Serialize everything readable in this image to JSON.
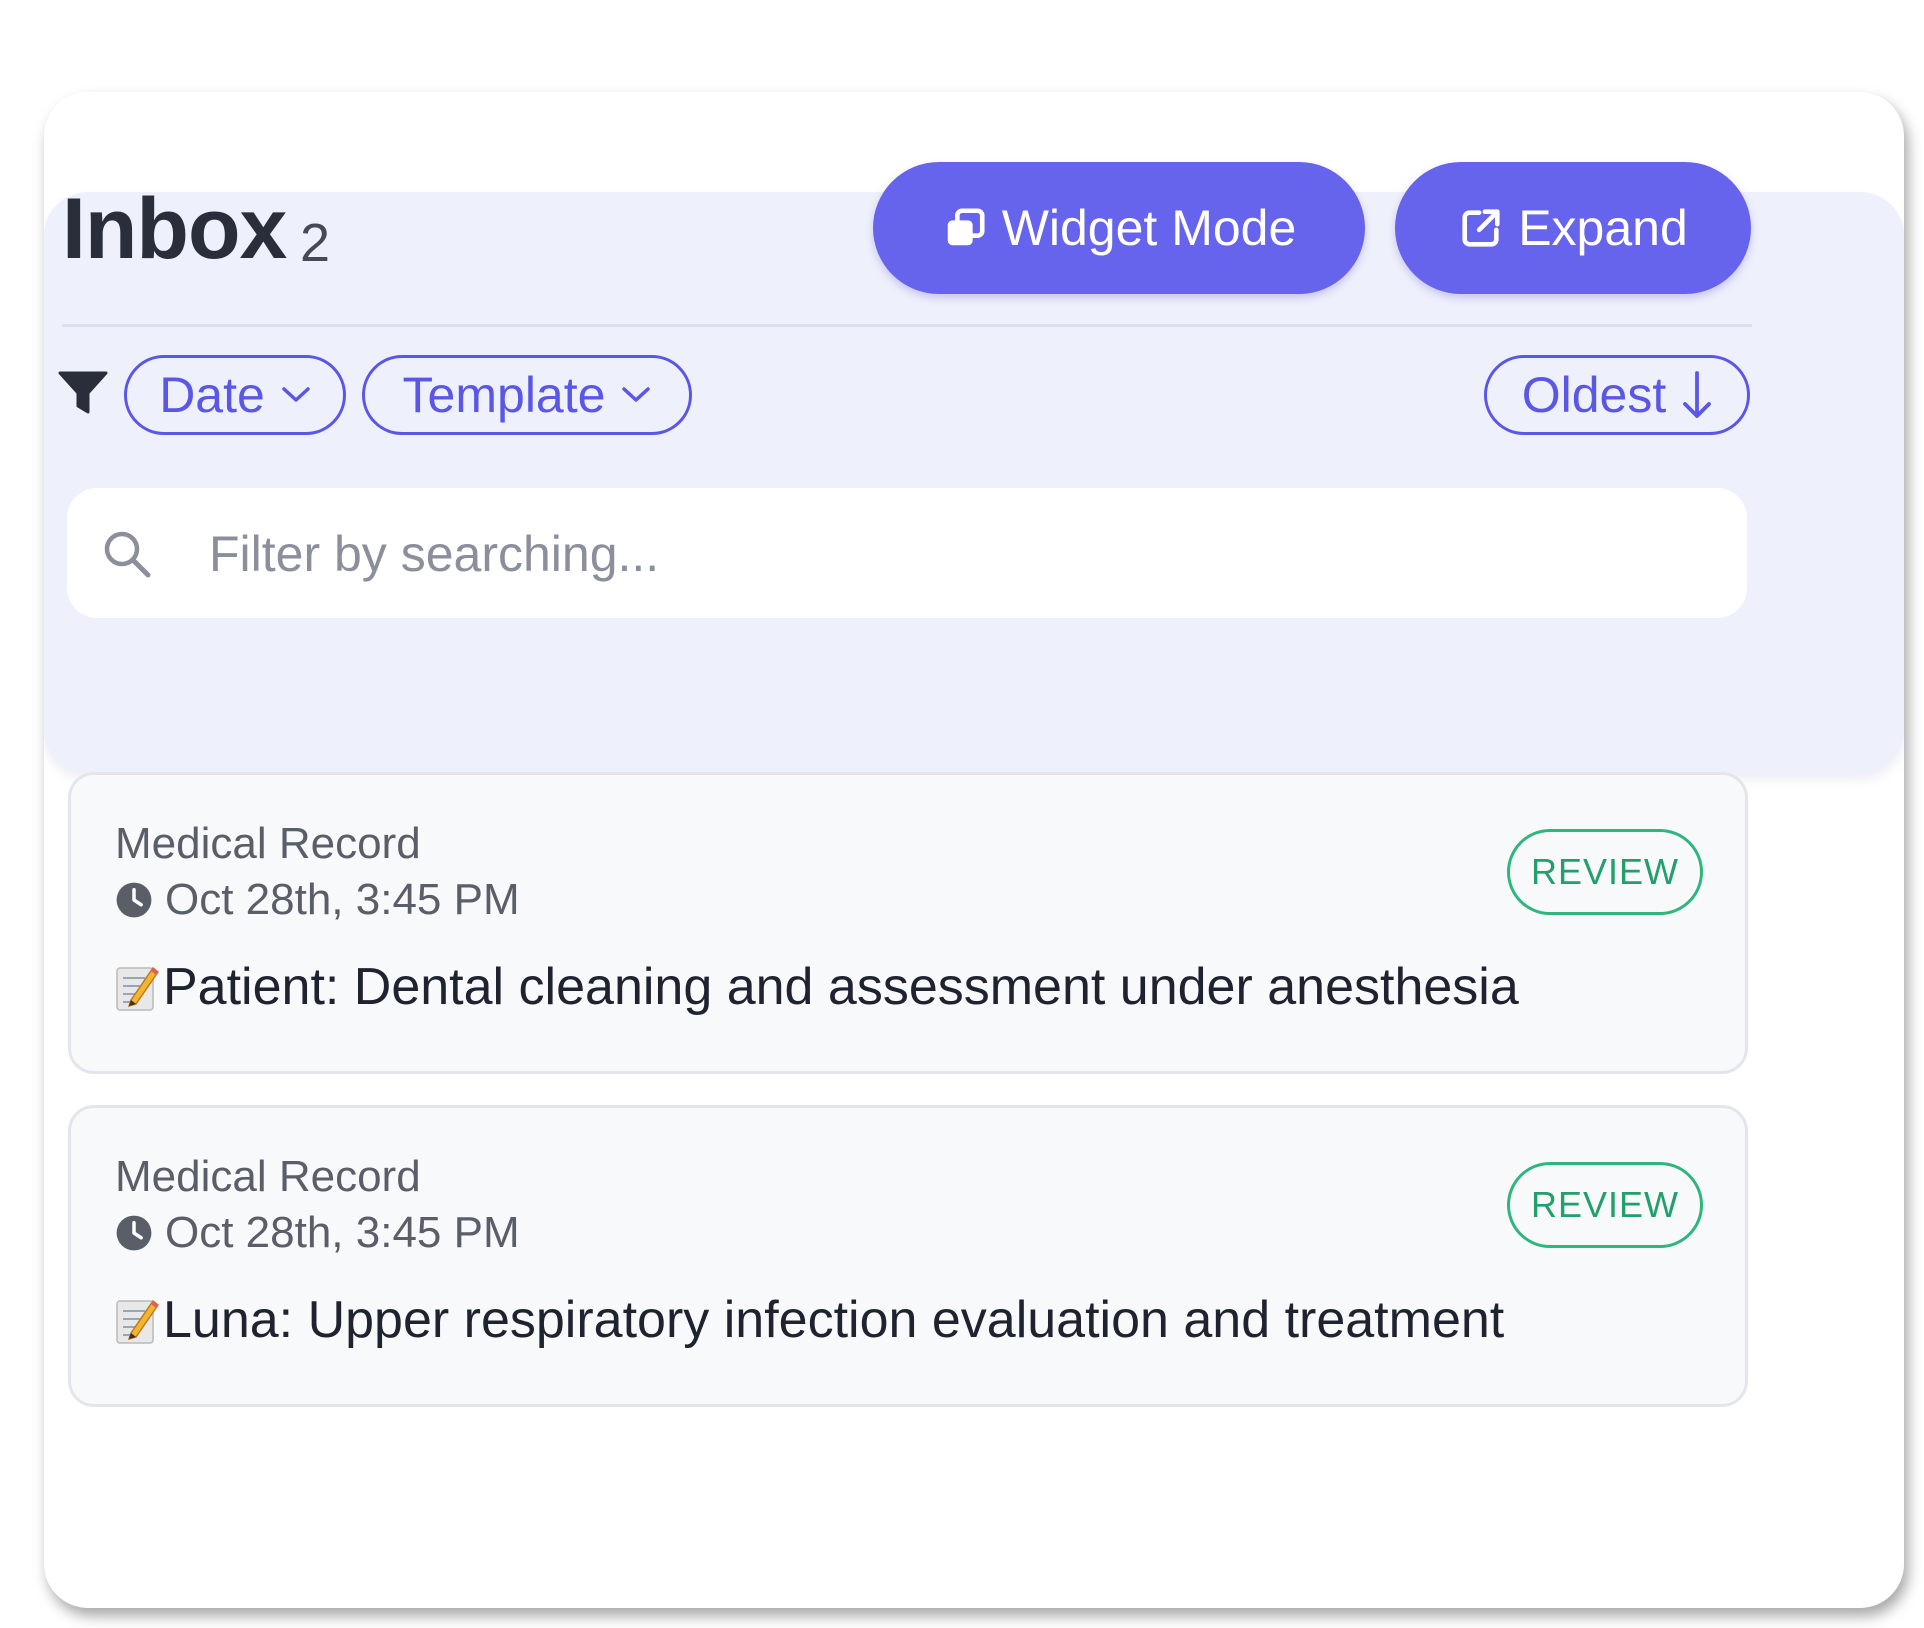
{
  "header": {
    "title": "Inbox",
    "count": "2",
    "widget_button": "Widget Mode",
    "expand_button": "Expand"
  },
  "filters": {
    "date": "Date",
    "template": "Template",
    "sort": "Oldest"
  },
  "search": {
    "placeholder": "Filter by searching..."
  },
  "records": [
    {
      "type": "Medical Record",
      "time": "Oct 28th, 3:45 PM",
      "title": "Patient: Dental cleaning and assessment under anesthesia",
      "status": "REVIEW"
    },
    {
      "type": "Medical Record",
      "time": "Oct 28th, 3:45 PM",
      "title": "Luna: Upper respiratory infection evaluation and treatment",
      "status": "REVIEW"
    }
  ],
  "colors": {
    "accent": "#6663ec",
    "panel": "#eef0fc",
    "review": "#2eb67d"
  },
  "icons": [
    "copy-icon",
    "external-link-icon",
    "filter-icon",
    "chevron-down-icon",
    "arrow-down-icon",
    "search-icon",
    "clock-icon",
    "memo-icon",
    "annotation-arrow"
  ]
}
